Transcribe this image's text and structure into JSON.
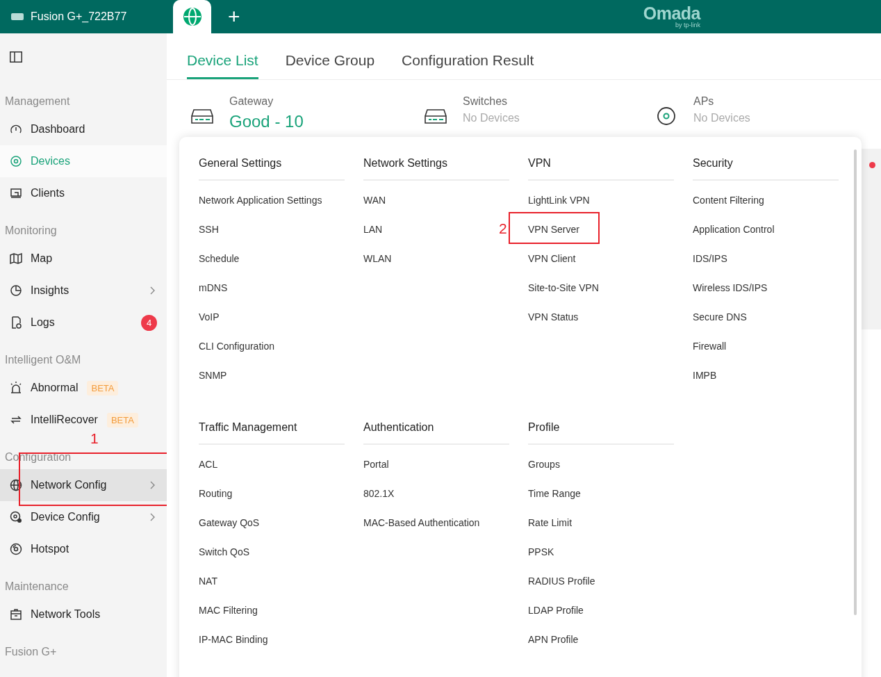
{
  "top_bar": {
    "site_tab": "Fusion G+_722B77",
    "logo": "Omada",
    "logo_sub": "by tp-link",
    "add_tab": "+"
  },
  "sidebar": {
    "sections": [
      {
        "title": "Management",
        "items": [
          {
            "label": "Dashboard",
            "selected": false
          },
          {
            "label": "Devices",
            "selected": true
          },
          {
            "label": "Clients",
            "selected": false
          }
        ]
      },
      {
        "title": "Monitoring",
        "items": [
          {
            "label": "Map",
            "selected": false
          },
          {
            "label": "Insights",
            "selected": false,
            "submenu": true
          },
          {
            "label": "Logs",
            "selected": false,
            "badge": "4"
          }
        ]
      },
      {
        "title": "Intelligent O&M",
        "items": [
          {
            "label": "Abnormal",
            "selected": false,
            "tag": "BETA"
          },
          {
            "label": "IntelliRecover",
            "selected": false,
            "tag": "BETA"
          }
        ]
      },
      {
        "title": "Configuration",
        "items": [
          {
            "label": "Network Config",
            "selected": false,
            "hovered": true,
            "submenu": true,
            "annotation": "1"
          },
          {
            "label": "Device Config",
            "selected": false,
            "submenu": true
          },
          {
            "label": "Hotspot",
            "selected": false
          }
        ]
      },
      {
        "title": "Maintenance",
        "items": [
          {
            "label": "Network Tools",
            "selected": false
          }
        ]
      },
      {
        "title": "Fusion G+"
      }
    ]
  },
  "tabs": [
    {
      "label": "Device List",
      "selected": true
    },
    {
      "label": "Device Group",
      "selected": false
    },
    {
      "label": "Configuration Result",
      "selected": false
    }
  ],
  "stats": [
    {
      "title": "Gateway",
      "value": "Good - 10",
      "good": true
    },
    {
      "title": "Switches",
      "value": "No Devices",
      "good": false
    },
    {
      "title": "APs",
      "value": "No Devices",
      "good": false
    }
  ],
  "menu": {
    "groups": [
      {
        "title": "General Settings",
        "items": [
          {
            "label": "Network Application Settings"
          },
          {
            "label": "SSH"
          },
          {
            "label": "Schedule"
          },
          {
            "label": "mDNS"
          },
          {
            "label": "VoIP"
          },
          {
            "label": "CLI Configuration"
          },
          {
            "label": "SNMP"
          }
        ]
      },
      {
        "title": "Network Settings",
        "items": [
          {
            "label": "WAN"
          },
          {
            "label": "LAN"
          },
          {
            "label": "WLAN"
          }
        ]
      },
      {
        "title": "VPN",
        "items": [
          {
            "label": "LightLink VPN"
          },
          {
            "label": "VPN Server",
            "annotation": "2"
          },
          {
            "label": "VPN Client"
          },
          {
            "label": "Site-to-Site VPN"
          },
          {
            "label": "VPN Status"
          }
        ]
      },
      {
        "title": "Security",
        "items": [
          {
            "label": "Content Filtering"
          },
          {
            "label": "Application Control"
          },
          {
            "label": "IDS/IPS"
          },
          {
            "label": "Wireless IDS/IPS"
          },
          {
            "label": "Secure DNS"
          },
          {
            "label": "Firewall"
          },
          {
            "label": "IMPB"
          }
        ]
      },
      {
        "title": "Traffic Management",
        "items": [
          {
            "label": "ACL"
          },
          {
            "label": "Routing"
          },
          {
            "label": "Gateway QoS"
          },
          {
            "label": "Switch QoS"
          },
          {
            "label": "NAT"
          },
          {
            "label": "MAC Filtering"
          },
          {
            "label": "IP-MAC Binding"
          }
        ]
      },
      {
        "title": "Authentication",
        "items": [
          {
            "label": "Portal"
          },
          {
            "label": "802.1X"
          },
          {
            "label": "MAC-Based Authentication"
          }
        ]
      },
      {
        "title": "Profile",
        "items": [
          {
            "label": "Groups"
          },
          {
            "label": "Time Range"
          },
          {
            "label": "Rate Limit"
          },
          {
            "label": "PPSK"
          },
          {
            "label": "RADIUS Profile"
          },
          {
            "label": "LDAP Profile"
          },
          {
            "label": "APN Profile"
          }
        ]
      }
    ]
  }
}
